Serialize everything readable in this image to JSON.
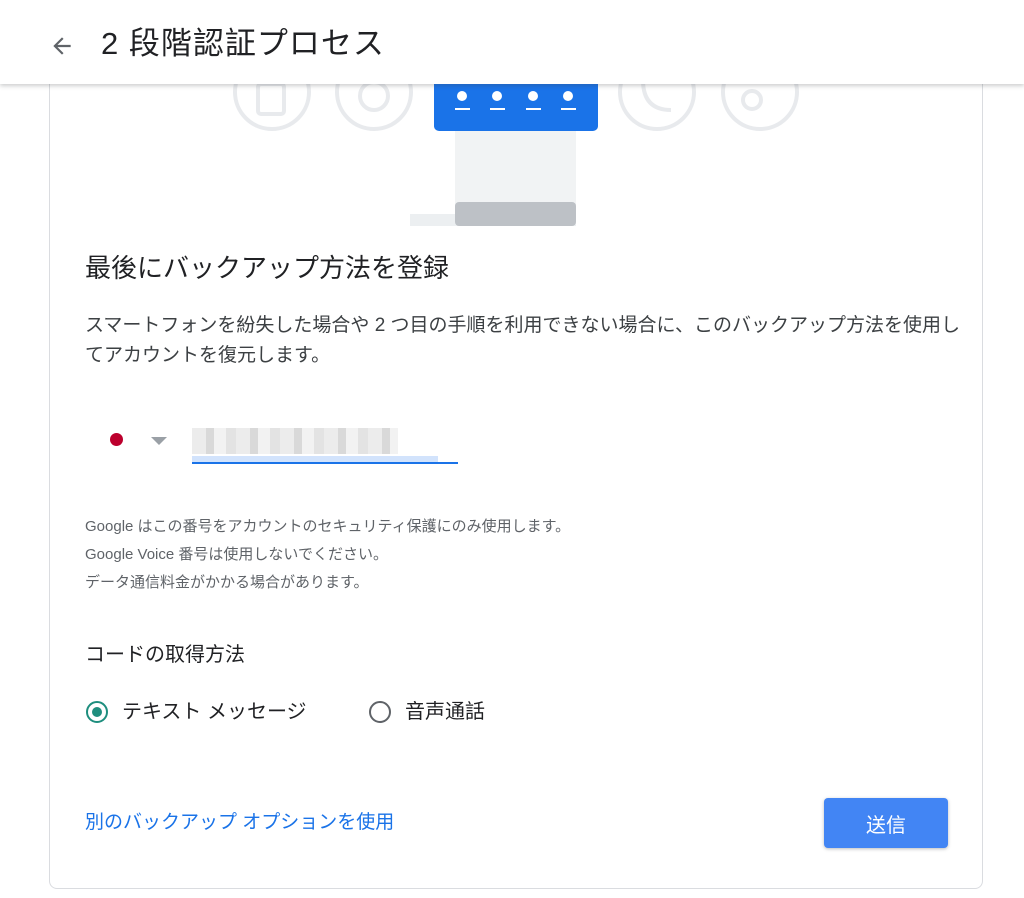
{
  "header": {
    "title": "2 段階認証プロセス"
  },
  "main": {
    "heading": "最後にバックアップ方法を登録",
    "description": "スマートフォンを紛失した場合や 2 つ目の手順を利用できない場合に、このバックアップ方法を使用してアカウントを復元します。",
    "phone": {
      "country_flag": "japan-flag",
      "value_redacted": true
    },
    "notes": [
      "Google はこの番号をアカウントのセキュリティ保護にのみ使用します。",
      "Google Voice 番号は使用しないでください。",
      "データ通信料金がかかる場合があります。"
    ],
    "code_method_label": "コードの取得方法",
    "options": [
      {
        "label": "テキスト メッセージ",
        "selected": true
      },
      {
        "label": "音声通話",
        "selected": false
      }
    ],
    "alt_link": "別のバックアップ オプションを使用",
    "send_button": "送信"
  },
  "colors": {
    "accent": "#1a73e8",
    "button": "#4285f4",
    "radio_selected": "#1e8e7e",
    "flag_red": "#bc002d"
  }
}
